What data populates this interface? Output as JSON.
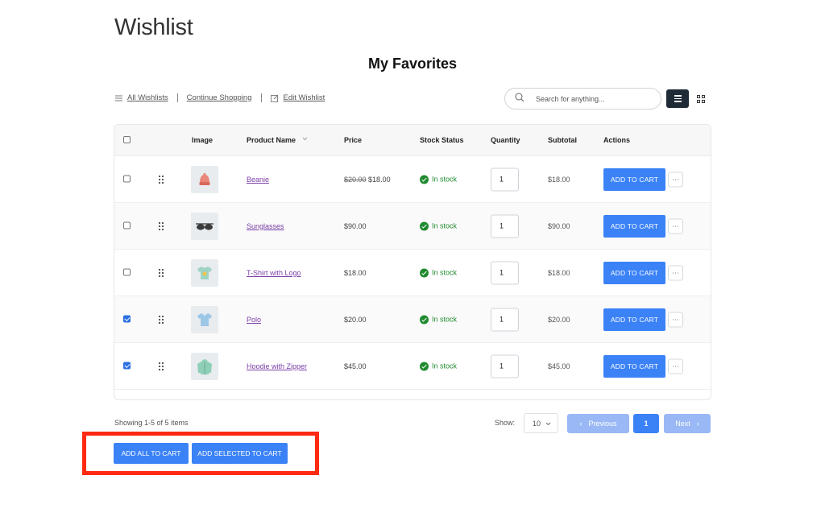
{
  "page": {
    "title": "Wishlist",
    "list_title": "My Favorites"
  },
  "toolbar": {
    "all_wishlists": "All Wishlists",
    "continue_shopping": "Continue Shopping",
    "edit_wishlist": "Edit Wishlist",
    "search_placeholder": "Search for anything..."
  },
  "table": {
    "headers": {
      "image": "Image",
      "product_name": "Product Name",
      "price": "Price",
      "stock_status": "Stock Status",
      "quantity": "Quantity",
      "subtotal": "Subtotal",
      "actions": "Actions"
    },
    "rows": [
      {
        "name": "Beanie",
        "old_price": "$20.00",
        "price": "$18.00",
        "stock": "In stock",
        "qty": "1",
        "subtotal": "$18.00",
        "action": "ADD TO CART",
        "checked": false,
        "image": "beanie"
      },
      {
        "name": "Sunglasses",
        "old_price": "",
        "price": "$90.00",
        "stock": "In stock",
        "qty": "1",
        "subtotal": "$90.00",
        "action": "ADD TO CART",
        "checked": false,
        "image": "sunglasses"
      },
      {
        "name": "T-Shirt with Logo",
        "old_price": "",
        "price": "$18.00",
        "stock": "In stock",
        "qty": "1",
        "subtotal": "$18.00",
        "action": "ADD TO CART",
        "checked": false,
        "image": "tshirt"
      },
      {
        "name": "Polo",
        "old_price": "",
        "price": "$20.00",
        "stock": "In stock",
        "qty": "1",
        "subtotal": "$20.00",
        "action": "ADD TO CART",
        "checked": true,
        "image": "polo"
      },
      {
        "name": "Hoodie with Zipper",
        "old_price": "",
        "price": "$45.00",
        "stock": "In stock",
        "qty": "1",
        "subtotal": "$45.00",
        "action": "ADD TO CART",
        "checked": true,
        "image": "hoodie"
      }
    ]
  },
  "pagination": {
    "showing": "Showing 1-5 of 5 items",
    "show_label": "Show:",
    "per_page": "10",
    "previous": "Previous",
    "current_page": "1",
    "next": "Next"
  },
  "actions": {
    "add_all": "ADD ALL TO CART",
    "add_selected": "ADD SELECTED TO CART"
  },
  "colors": {
    "accent": "#3b82f6",
    "accent_disabled": "#9ab8f5",
    "in_stock": "#1f8a2e",
    "highlight": "#ff2a12",
    "link": "#7a3fa8"
  }
}
